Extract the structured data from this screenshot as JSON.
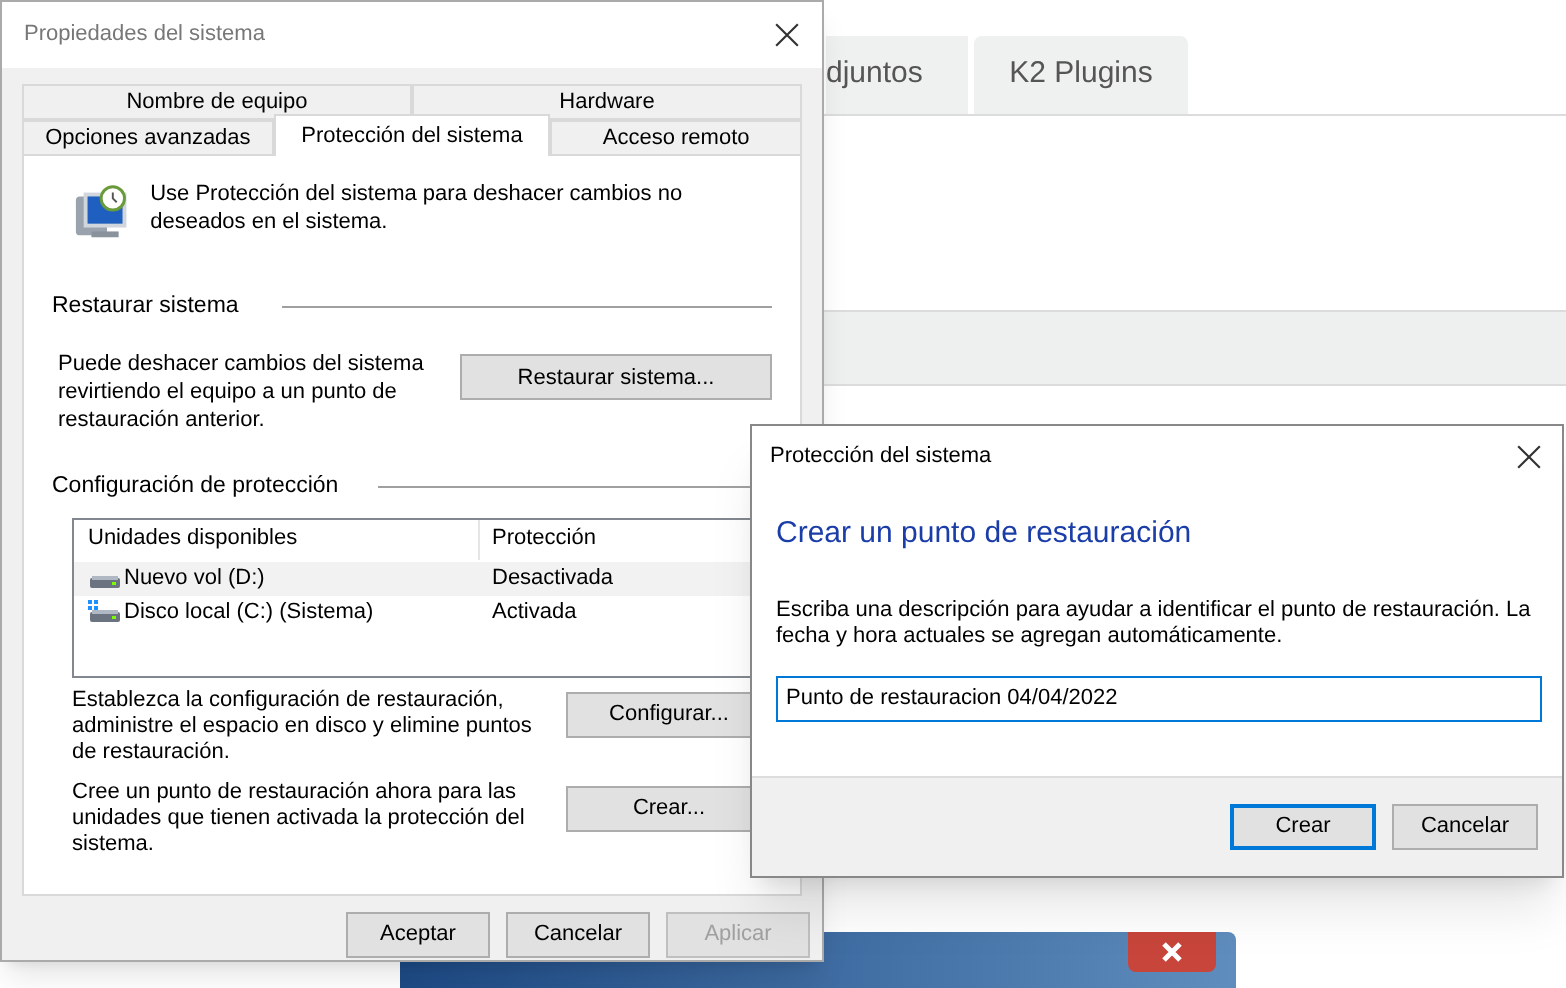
{
  "background_page": {
    "tabs": [
      {
        "label": "djuntos"
      },
      {
        "label": "K2 Plugins"
      }
    ]
  },
  "system_properties": {
    "title": "Propiedades del sistema",
    "tab_rows": [
      [
        {
          "label": "Nombre de equipo",
          "selected": false
        },
        {
          "label": "Hardware",
          "selected": false
        }
      ],
      [
        {
          "label": "Opciones avanzadas",
          "selected": false
        },
        {
          "label": "Protección del sistema",
          "selected": true
        },
        {
          "label": "Acceso remoto",
          "selected": false
        }
      ]
    ],
    "intro": "Use Protección del sistema para deshacer cambios no deseados en el sistema.",
    "restore": {
      "heading": "Restaurar sistema",
      "description": "Puede deshacer cambios del sistema revirtiendo el equipo a un punto de restauración anterior.",
      "button": "Restaurar sistema..."
    },
    "protection": {
      "heading": "Configuración de protección",
      "columns": [
        "Unidades disponibles",
        "Protección"
      ],
      "rows": [
        {
          "kind": "data",
          "drive": "Nuevo vol (D:)",
          "protection": "Desactivada",
          "selected": true
        },
        {
          "kind": "system",
          "drive": "Disco local (C:) (Sistema)",
          "protection": "Activada",
          "selected": false
        }
      ],
      "configure_text": "Establezca la configuración de restauración, administre el espacio en disco y elimine puntos de restauración.",
      "configure_button": "Configurar...",
      "create_text": "Cree un punto de restauración ahora para las unidades que tienen activada la protección del sistema.",
      "create_button": "Crear..."
    },
    "buttons": [
      {
        "label": "Aceptar",
        "disabled": false
      },
      {
        "label": "Cancelar",
        "disabled": false
      },
      {
        "label": "Aplicar",
        "disabled": true
      }
    ]
  },
  "restore_point_dialog": {
    "title": "Protección del sistema",
    "heading": "Crear un punto de restauración",
    "description": "Escriba una descripción para ayudar a identificar el punto de restauración. La fecha y hora actuales se agregan automáticamente.",
    "value": "Punto de restauracion 04/04/2022",
    "buttons": [
      {
        "label": "Crear",
        "default": true
      },
      {
        "label": "Cancelar",
        "default": false
      }
    ]
  }
}
